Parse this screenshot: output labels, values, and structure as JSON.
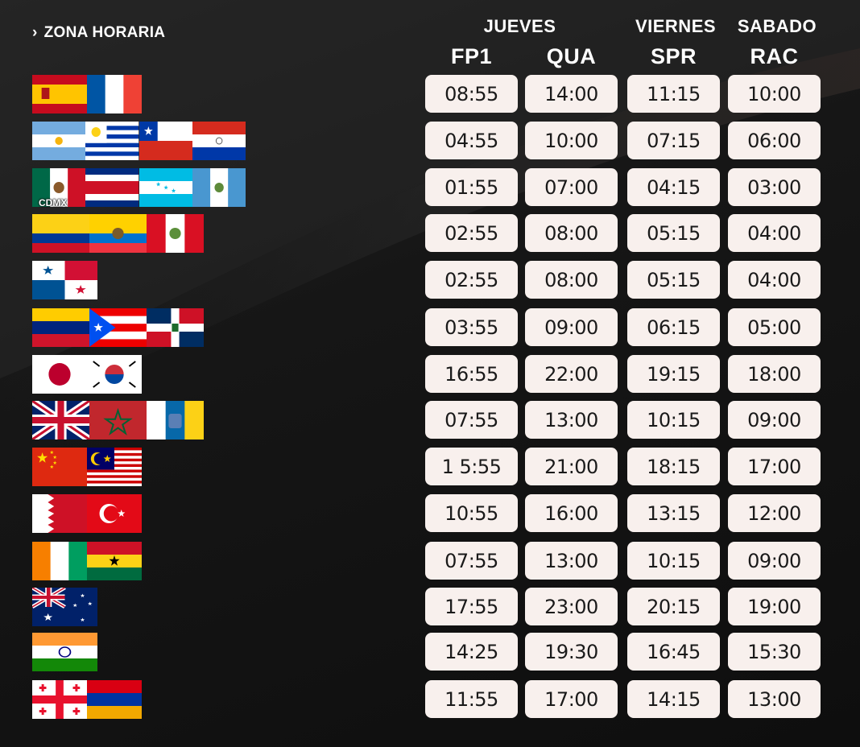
{
  "header": {
    "zone_label": "ZONA HORARIA",
    "days": [
      "JUEVES",
      "VIERNES",
      "SABADO"
    ],
    "sessions": [
      "FP1",
      "QUA",
      "SPR",
      "RAC"
    ]
  },
  "rows": [
    {
      "flags": [
        "spain",
        "france"
      ],
      "times": [
        "08:55",
        "14:00",
        "11:15",
        "10:00"
      ]
    },
    {
      "flags": [
        "argentina",
        "uruguay",
        "chile",
        "paraguay"
      ],
      "times": [
        "04:55",
        "10:00",
        "07:15",
        "06:00"
      ]
    },
    {
      "flags": [
        "mexico",
        "costa-rica",
        "honduras",
        "guatemala"
      ],
      "label": "CDMX",
      "times": [
        "01:55",
        "07:00",
        "04:15",
        "03:00"
      ]
    },
    {
      "flags": [
        "colombia",
        "ecuador",
        "peru"
      ],
      "times": [
        "02:55",
        "08:00",
        "05:15",
        "04:00"
      ]
    },
    {
      "flags": [
        "panama"
      ],
      "times": [
        "02:55",
        "08:00",
        "05:15",
        "04:00"
      ]
    },
    {
      "flags": [
        "venezuela",
        "puerto-rico",
        "dominican-republic"
      ],
      "times": [
        "03:55",
        "09:00",
        "06:15",
        "05:00"
      ]
    },
    {
      "flags": [
        "japan",
        "south-korea"
      ],
      "times": [
        "16:55",
        "22:00",
        "19:15",
        "18:00"
      ]
    },
    {
      "flags": [
        "united-kingdom",
        "morocco",
        "canary-islands"
      ],
      "times": [
        "07:55",
        "13:00",
        "10:15",
        "09:00"
      ]
    },
    {
      "flags": [
        "china",
        "malaysia"
      ],
      "times": [
        "1 5:55",
        "21:00",
        "18:15",
        "17:00"
      ]
    },
    {
      "flags": [
        "bahrain",
        "turkey"
      ],
      "times": [
        "10:55",
        "16:00",
        "13:15",
        "12:00"
      ]
    },
    {
      "flags": [
        "ivory-coast",
        "ghana"
      ],
      "times": [
        "07:55",
        "13:00",
        "10:15",
        "09:00"
      ]
    },
    {
      "flags": [
        "australia"
      ],
      "times": [
        "17:55",
        "23:00",
        "20:15",
        "19:00"
      ]
    },
    {
      "flags": [
        "india"
      ],
      "times": [
        "14:25",
        "19:30",
        "16:45",
        "15:30"
      ]
    },
    {
      "flags": [
        "georgia",
        "armenia"
      ],
      "times": [
        "11:55",
        "17:00",
        "14:15",
        "13:00"
      ]
    }
  ]
}
